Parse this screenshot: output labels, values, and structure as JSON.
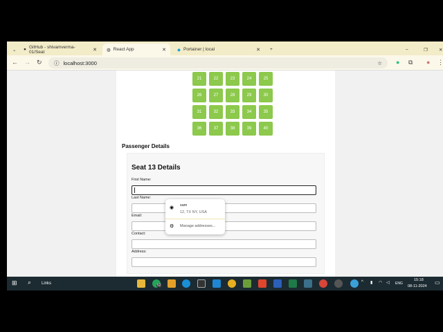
{
  "browser": {
    "tabs": [
      {
        "title": "GitHub - shivamverma-01/Seat",
        "active": false
      },
      {
        "title": "React App",
        "active": true
      },
      {
        "title": "Portainer | local",
        "active": false
      }
    ],
    "url": "localhost:3000"
  },
  "seats": [
    "21",
    "22",
    "23",
    "24",
    "25",
    "26",
    "27",
    "28",
    "29",
    "30",
    "31",
    "32",
    "33",
    "34",
    "35",
    "36",
    "37",
    "38",
    "39",
    "40"
  ],
  "seat_color": "#8cc94c",
  "passenger_heading": "Passenger Details",
  "form": {
    "title": "Seat 13 Details",
    "fields": [
      {
        "label": "First Name:",
        "value": ""
      },
      {
        "label": "Last Name:",
        "value": ""
      },
      {
        "label": "Email:",
        "value": ""
      },
      {
        "label": "Contact:",
        "value": ""
      },
      {
        "label": "Address:",
        "value": ""
      }
    ]
  },
  "autofill": {
    "name": "sam",
    "address": "12, TX NY, USA",
    "manage": "Manage addresses..."
  },
  "taskbar": {
    "search": "Links",
    "whatsapp_badge": "52",
    "lang": "ENG",
    "time": "15:18",
    "date": "08-11-2024"
  }
}
